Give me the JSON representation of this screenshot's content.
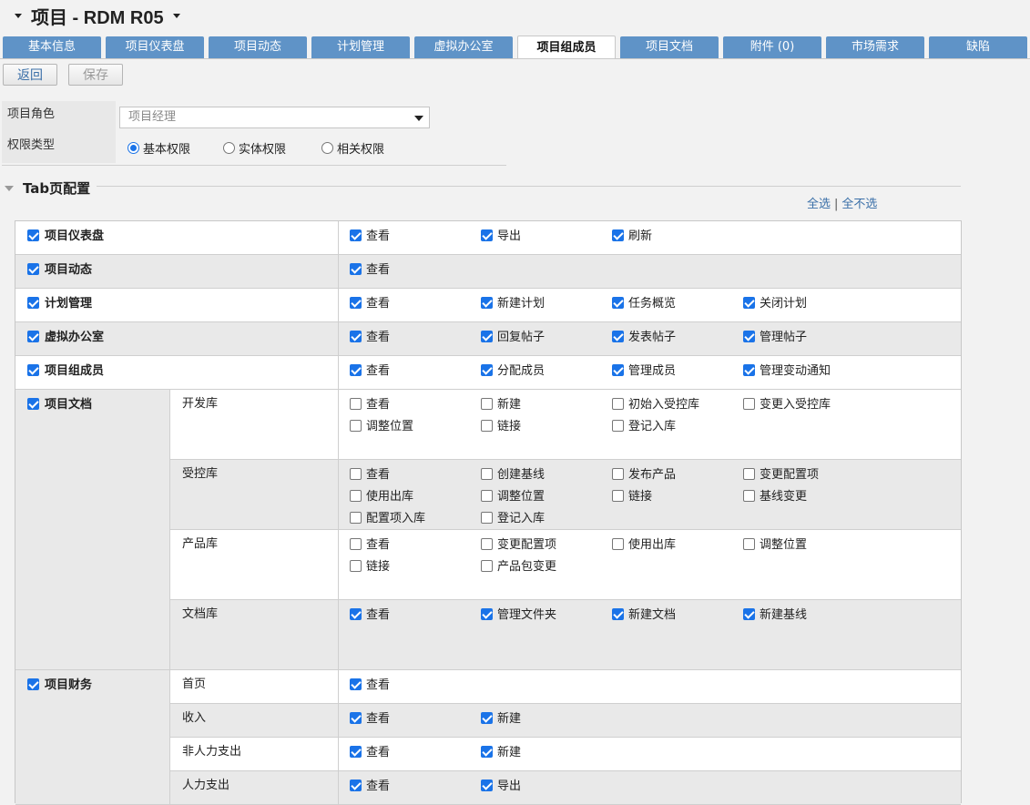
{
  "header": {
    "title": "项目 - RDM R05"
  },
  "tabs": [
    {
      "label": "基本信息",
      "active": false
    },
    {
      "label": "项目仪表盘",
      "active": false
    },
    {
      "label": "项目动态",
      "active": false
    },
    {
      "label": "计划管理",
      "active": false
    },
    {
      "label": "虚拟办公室",
      "active": false
    },
    {
      "label": "项目组成员",
      "active": true
    },
    {
      "label": "项目文档",
      "active": false
    },
    {
      "label": "附件 (0)",
      "active": false
    },
    {
      "label": "市场需求",
      "active": false
    },
    {
      "label": "缺陷",
      "active": false
    }
  ],
  "toolbar": {
    "back_label": "返回",
    "save_label": "保存"
  },
  "form": {
    "role_label": "项目角色",
    "role_value": "项目经理",
    "perm_label": "权限类型",
    "perm_options": [
      {
        "label": "基本权限",
        "selected": true
      },
      {
        "label": "实体权限",
        "selected": false
      },
      {
        "label": "相关权限",
        "selected": false
      }
    ]
  },
  "section": {
    "title": "Tab页配置",
    "select_all": "全选",
    "separator": "|",
    "select_none": "全不选"
  },
  "rows": [
    {
      "tab": "项目仪表盘",
      "checked": true,
      "sub": [
        {
          "name": "",
          "perms": [
            [
              "查看",
              true
            ],
            [
              "导出",
              true
            ],
            [
              "刷新",
              true
            ]
          ]
        }
      ]
    },
    {
      "tab": "项目动态",
      "checked": true,
      "sub": [
        {
          "name": "",
          "perms": [
            [
              "查看",
              true
            ]
          ]
        }
      ]
    },
    {
      "tab": "计划管理",
      "checked": true,
      "sub": [
        {
          "name": "",
          "perms": [
            [
              "查看",
              true
            ],
            [
              "新建计划",
              true
            ],
            [
              "任务概览",
              true
            ],
            [
              "关闭计划",
              true
            ]
          ]
        }
      ]
    },
    {
      "tab": "虚拟办公室",
      "checked": true,
      "sub": [
        {
          "name": "",
          "perms": [
            [
              "查看",
              true
            ],
            [
              "回复帖子",
              true
            ],
            [
              "发表帖子",
              true
            ],
            [
              "管理帖子",
              true
            ]
          ]
        }
      ]
    },
    {
      "tab": "项目组成员",
      "checked": true,
      "sub": [
        {
          "name": "",
          "perms": [
            [
              "查看",
              true
            ],
            [
              "分配成员",
              true
            ],
            [
              "管理成员",
              true
            ],
            [
              "管理变动通知",
              true
            ]
          ]
        }
      ]
    },
    {
      "tab": "项目文档",
      "checked": true,
      "sub": [
        {
          "name": "开发库",
          "perms": [
            [
              "查看",
              false
            ],
            [
              "新建",
              false
            ],
            [
              "初始入受控库",
              false
            ],
            [
              "变更入受控库",
              false
            ],
            [
              "调整位置",
              false
            ],
            [
              "链接",
              false
            ],
            [
              "登记入库",
              false
            ]
          ]
        },
        {
          "name": "受控库",
          "perms": [
            [
              "查看",
              false
            ],
            [
              "创建基线",
              false
            ],
            [
              "发布产品",
              false
            ],
            [
              "变更配置项",
              false
            ],
            [
              "使用出库",
              false
            ],
            [
              "调整位置",
              false
            ],
            [
              "链接",
              false
            ],
            [
              "基线变更",
              false
            ],
            [
              "配置项入库",
              false
            ],
            [
              "登记入库",
              false
            ]
          ]
        },
        {
          "name": "产品库",
          "perms": [
            [
              "查看",
              false
            ],
            [
              "变更配置项",
              false
            ],
            [
              "使用出库",
              false
            ],
            [
              "调整位置",
              false
            ],
            [
              "链接",
              false
            ],
            [
              "产品包变更",
              false
            ]
          ]
        },
        {
          "name": "文档库",
          "perms": [
            [
              "查看",
              true
            ],
            [
              "管理文件夹",
              true
            ],
            [
              "新建文档",
              true
            ],
            [
              "新建基线",
              true
            ]
          ]
        }
      ]
    },
    {
      "tab": "项目财务",
      "checked": true,
      "sub": [
        {
          "name": "首页",
          "perms": [
            [
              "查看",
              true
            ]
          ]
        },
        {
          "name": "收入",
          "perms": [
            [
              "查看",
              true
            ],
            [
              "新建",
              true
            ]
          ]
        },
        {
          "name": "非人力支出",
          "perms": [
            [
              "查看",
              true
            ],
            [
              "新建",
              true
            ]
          ]
        },
        {
          "name": "人力支出",
          "perms": [
            [
              "查看",
              true
            ],
            [
              "导出",
              true
            ]
          ]
        }
      ]
    }
  ]
}
